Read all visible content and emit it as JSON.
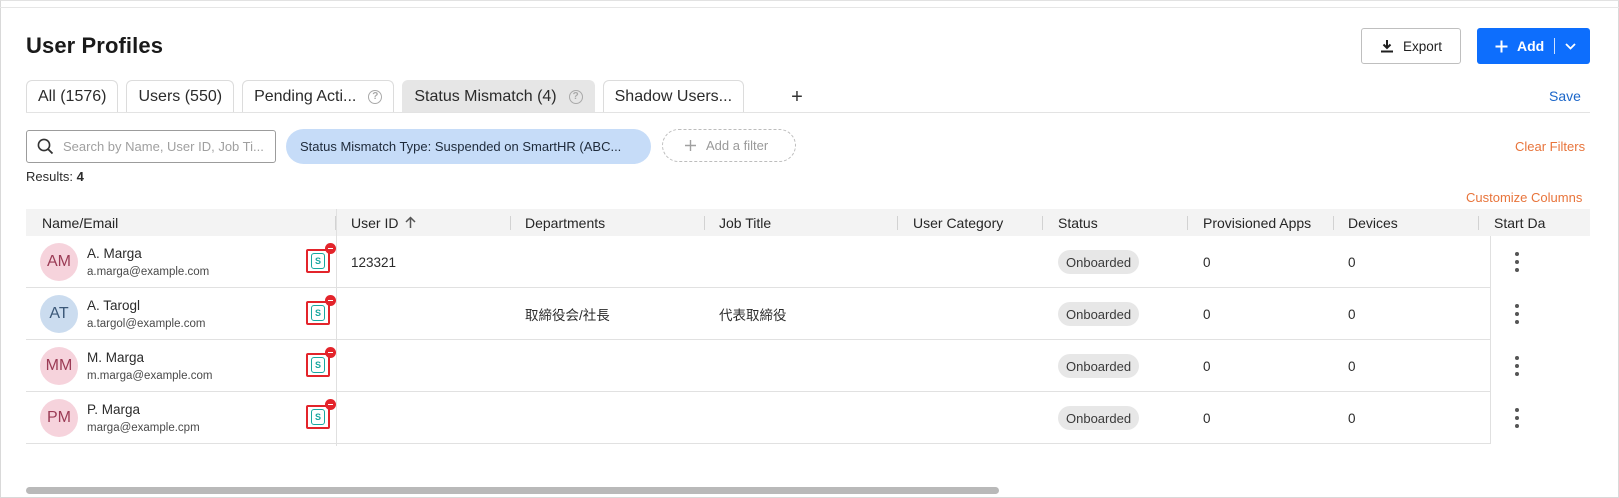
{
  "page": {
    "title": "User Profiles"
  },
  "toolbar": {
    "export_label": "Export",
    "add_label": "Add"
  },
  "tabs": [
    {
      "label": "All (1576)",
      "help": false,
      "active": false
    },
    {
      "label": "Users (550)",
      "help": false,
      "active": false
    },
    {
      "label": "Pending Acti...",
      "help": true,
      "active": false
    },
    {
      "label": "Status Mismatch (4)",
      "help": true,
      "active": true
    },
    {
      "label": "Shadow Users...",
      "help": false,
      "active": false
    }
  ],
  "tab_add_label": "+",
  "save_label": "Save",
  "help_glyph": "?",
  "search": {
    "placeholder": "Search by Name, User ID, Job Ti..."
  },
  "filters": {
    "active_chip": "Status Mismatch Type: Suspended on SmartHR (ABC...",
    "add_filter_label": "Add a filter",
    "clear_label": "Clear Filters"
  },
  "results": {
    "label": "Results:",
    "count": "4"
  },
  "customize_columns_label": "Customize Columns",
  "table": {
    "columns": [
      "Name/Email",
      "User ID",
      "Departments",
      "Job Title",
      "User Category",
      "Status",
      "Provisioned Apps",
      "Devices",
      "Start Da"
    ],
    "sort_column": "User ID",
    "sort_direction": "ascending",
    "rows": [
      {
        "initials": "AM",
        "avatar_color": "#f6d3dc",
        "name": "A. Marga",
        "email": "a.marga@example.com",
        "user_id": "123321",
        "department": "",
        "job_title": "",
        "user_category": "",
        "status": "Onboarded",
        "provisioned_apps": "0",
        "devices": "0"
      },
      {
        "initials": "AT",
        "avatar_color": "#cbdcef",
        "name": "A. Tarogl",
        "email": "a.targol@example.com",
        "user_id": "",
        "department": "取締役会/社長",
        "job_title": "代表取締役",
        "user_category": "",
        "status": "Onboarded",
        "provisioned_apps": "0",
        "devices": "0"
      },
      {
        "initials": "MM",
        "avatar_color": "#f6d3dc",
        "name": "M. Marga",
        "email": "m.marga@example.com",
        "user_id": "",
        "department": "",
        "job_title": "",
        "user_category": "",
        "status": "Onboarded",
        "provisioned_apps": "0",
        "devices": "0"
      },
      {
        "initials": "PM",
        "avatar_color": "#f6d3dc",
        "name": "P. Marga",
        "email": "marga@example.cpm",
        "user_id": "",
        "department": "",
        "job_title": "",
        "user_category": "",
        "status": "Onboarded",
        "provisioned_apps": "0",
        "devices": "0"
      }
    ],
    "app_icon_glyph": "S"
  },
  "colors": {
    "primary": "#0d6efd",
    "link": "#1b66c9",
    "accent_orange": "#e8743b",
    "filter_chip": "#c6dcf8",
    "warning_red": "#e3242b",
    "app_teal": "#18a7a0"
  },
  "icons": {
    "export": "download-icon",
    "add": "plus-icon",
    "add_menu": "chevron-down-icon",
    "search": "search-icon",
    "add_filter": "plus-icon",
    "sort": "arrow-up-icon",
    "row_menu": "more-vertical-icon",
    "app": "smarthr-app-icon",
    "app_badge": "minus-circle-icon"
  }
}
